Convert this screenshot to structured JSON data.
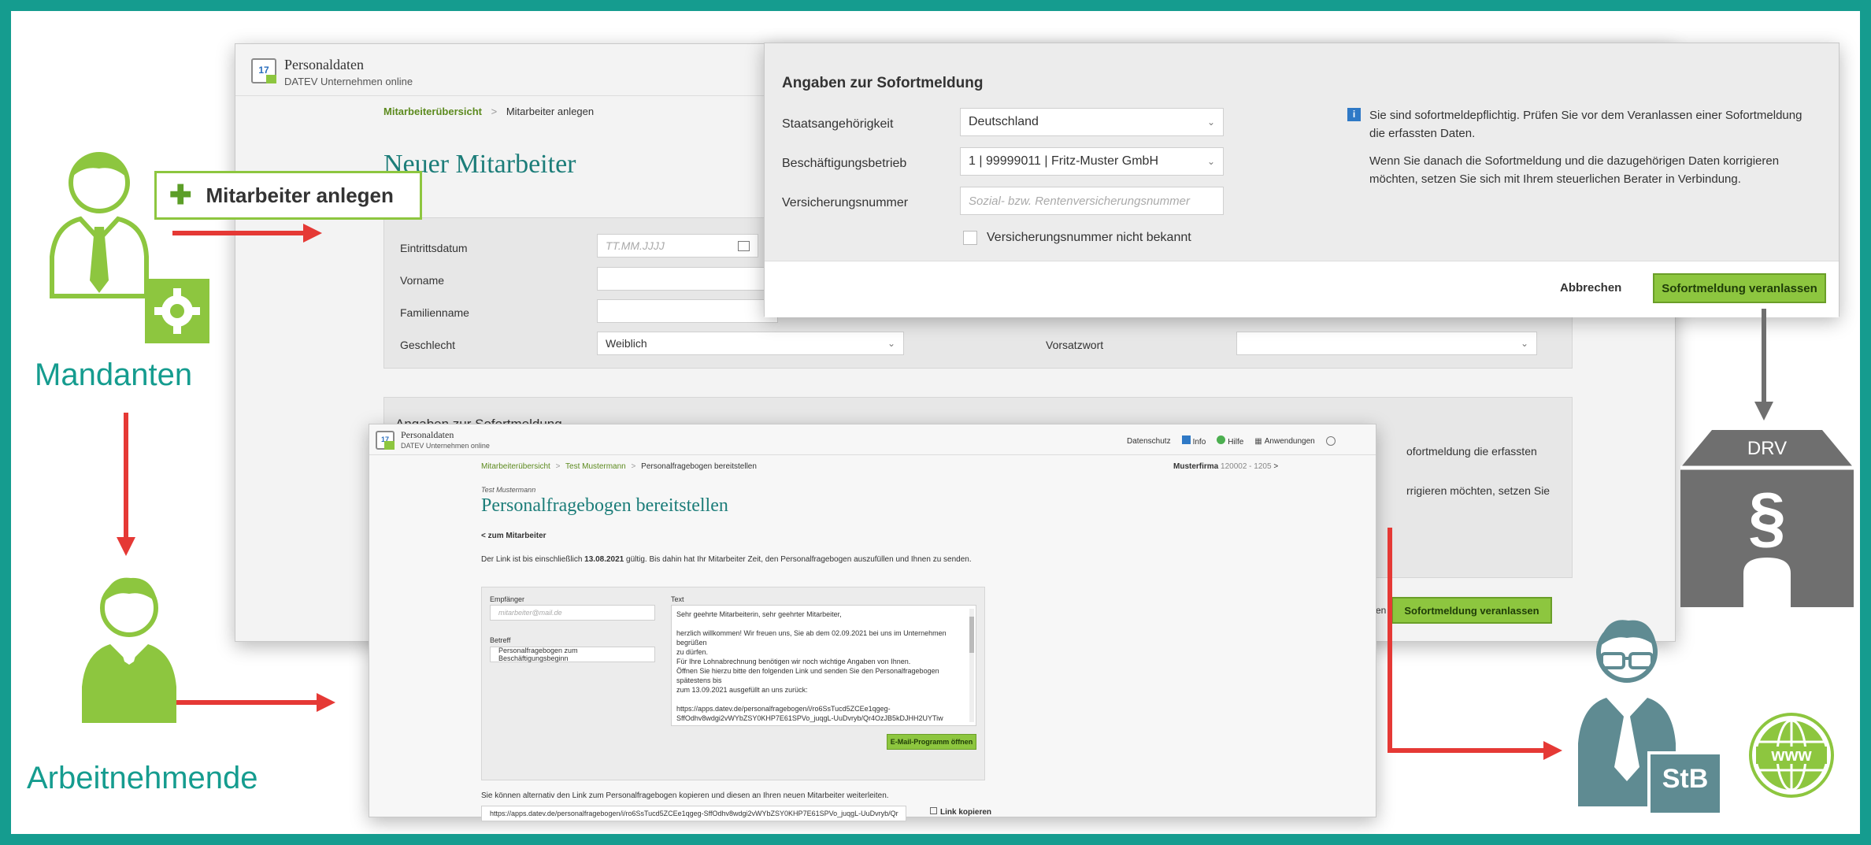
{
  "back": {
    "app_title": "Personaldaten",
    "app_subtitle": "DATEV Unternehmen online",
    "calendar_num": "17",
    "crumbs": [
      "Mitarbeiterübersicht",
      "Mitarbeiter anlegen"
    ],
    "page_title": "Neuer Mitarbeiter",
    "labels": {
      "eintritt": "Eintrittsdatum",
      "vorname": "Vorname",
      "familienname": "Familienname",
      "geschlecht": "Geschlecht",
      "vorsatzwort": "Vorsatzwort"
    },
    "date_placeholder": "TT.MM.JJJJ",
    "geschlecht_value": "Weiblich",
    "section_title": "Angaben zur Sofortmeldung",
    "partial_info": [
      "ofortmeldung die erfassten",
      "rrigieren möchten, setzen Sie"
    ],
    "partial_cancel": "en",
    "submit": "Sofortmeldung veranlassen"
  },
  "overlay": {
    "callout": "Mitarbeiter anlegen",
    "callout_icon": "plus-icon"
  },
  "dialog": {
    "title": "Angaben zur Sofortmeldung",
    "labels": {
      "staat": "Staatsangehörigkeit",
      "betrieb": "Beschäftigungsbetrieb",
      "vnr": "Versicherungsnummer"
    },
    "staat_value": "Deutschland",
    "betrieb_value": "1 | 99999011 | Fritz-Muster GmbH",
    "vnr_placeholder": "Sozial- bzw. Rentenversicherungsnummer",
    "checkbox_label": "Versicherungsnummer nicht bekannt",
    "info_1": "Sie sind sofortmeldepflichtig. Prüfen Sie vor dem Veranlassen einer Sofortmeldung die erfassten Daten.",
    "info_2": "Wenn Sie danach die Sofortmeldung und die dazugehörigen Daten korrigieren möchten, setzen Sie sich mit Ihrem steuerlichen Berater in Verbindung.",
    "cancel": "Abbrechen",
    "submit": "Sofortmeldung veranlassen"
  },
  "front": {
    "app_title": "Personaldaten",
    "app_subtitle": "DATEV Unternehmen online",
    "calendar_num": "17",
    "top_links": [
      "Datenschutz",
      "Info",
      "Hilfe",
      "Anwendungen"
    ],
    "crumbs": [
      "Mitarbeiterübersicht",
      "Test Mustermann",
      "Personalfragebogen bereitstellen"
    ],
    "firm": "Musterfirma",
    "firm_no": "120002 - 1205",
    "employee_name": "Test Mustermann",
    "page_title": "Personalfragebogen bereitstellen",
    "back_link": "zum Mitarbeiter",
    "valid_pre": "Der Link ist bis einschließlich ",
    "valid_date": "13.08.2021",
    "valid_post": " gültig. Bis dahin hat Ihr Mitarbeiter Zeit, den Personalfragebogen auszufüllen und Ihnen zu senden.",
    "empfaenger_label": "Empfänger",
    "empfaenger_placeholder": "mitarbeiter@mail.de",
    "betreff_label": "Betreff",
    "betreff_value": "Personalfragebogen zum Beschäftigungsbeginn",
    "text_label": "Text",
    "text_lines": [
      "Sehr geehrte Mitarbeiterin, sehr geehrter Mitarbeiter,",
      "",
      "herzlich willkommen! Wir freuen uns, Sie ab dem 02.09.2021 bei uns im Unternehmen begrüßen",
      "zu dürfen.",
      "Für Ihre Lohnabrechnung benötigen wir noch wichtige Angaben von Ihnen.",
      "Öffnen Sie hierzu bitte den folgenden Link und senden Sie den Personalfragebogen spätestens bis",
      "zum 13.09.2021 ausgefüllt an uns zurück:",
      "",
      "https://apps.datev.de/personalfragebogen/i/ro6SsTucd5ZCEe1qgeg-",
      "SffOdhv8wdgi2vWYbZSY0KHP7E61SPVo_juqgL-UuDvryb/Qr4OzJB5kDJHH2UYTiw"
    ],
    "email_btn": "E-Mail-Programm öffnen",
    "copy_text": "Sie können alternativ den Link zum Personalfragebogen kopieren und diesen an Ihren neuen Mitarbeiter weiterleiten.",
    "link_value": "https://apps.datev.de/personalfragebogen/i/ro6SsTucd5ZCEe1qgeg-SffOdhv8wdgi2vWYbZSY0KHP7E61SPVo_juqgL-UuDvryb/Qr",
    "copy_btn": "Link kopieren"
  },
  "personas": {
    "mandanten": "Mandanten",
    "arbeitnehmende": "Arbeitnehmende"
  },
  "drv_label": "DRV",
  "drv_symbol": "§",
  "stb_label": "StB",
  "www_label": "www",
  "colors": {
    "teal": "#159c8f",
    "green": "#8dc63f",
    "red": "#e53935",
    "gray": "#6f6f6f",
    "blue_gray": "#5f8b92"
  }
}
